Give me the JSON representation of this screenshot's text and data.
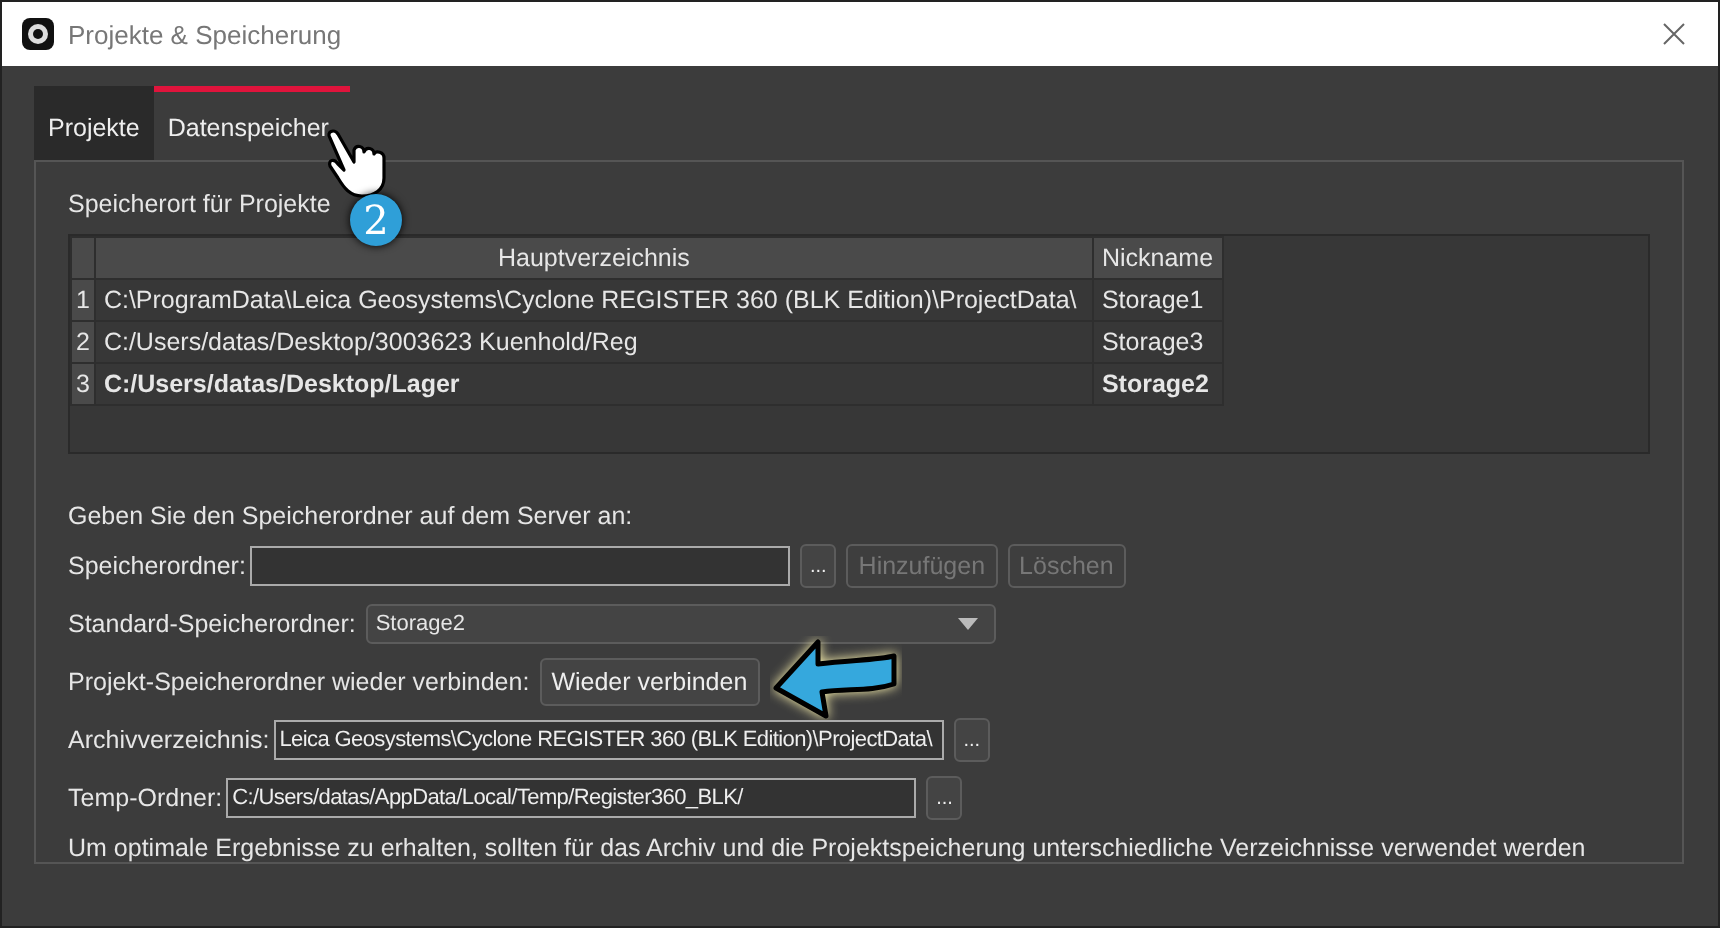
{
  "window": {
    "title": "Projekte & Speicherung"
  },
  "tabs": [
    {
      "label": "Projekte",
      "selected": false
    },
    {
      "label": "Datenspeicher",
      "selected": true
    }
  ],
  "callout": {
    "badge": "2"
  },
  "storage_table": {
    "title": "Speicherort für Projekte",
    "columns": [
      "Hauptverzeichnis",
      "Nickname"
    ],
    "rows": [
      {
        "index": "1",
        "path": "C:\\ProgramData\\Leica Geosystems\\Cyclone REGISTER 360 (BLK Edition)\\ProjectData\\",
        "nickname": "Storage1",
        "is_default": false
      },
      {
        "index": "2",
        "path": "C:/Users/datas/Desktop/3003623 Kuenhold/Reg",
        "nickname": "Storage3",
        "is_default": false
      },
      {
        "index": "3",
        "path": "C:/Users/datas/Desktop/Lager",
        "nickname": "Storage2",
        "is_default": true
      }
    ]
  },
  "server_prompt": "Geben Sie den Speicherordner auf dem Server an:",
  "storage_folder": {
    "label": "Speicherordner:",
    "browse": "...",
    "add": {
      "label": "Hinzufügen",
      "disabled": true
    },
    "delete": {
      "label": "Löschen",
      "disabled": true
    }
  },
  "default_folder": {
    "label": "Standard-Speicherordner:",
    "value": "Storage2"
  },
  "reconnect": {
    "label": "Projekt-Speicherordner wieder verbinden:",
    "button": "Wieder verbinden"
  },
  "archive": {
    "label": "Archivverzeichnis:",
    "value": "Leica Geosystems\\Cyclone REGISTER 360 (BLK Edition)\\ProjectData\\",
    "browse": "..."
  },
  "temp": {
    "label": "Temp-Ordner:",
    "value": "C:/Users/datas/AppData/Local/Temp/Register360_BLK/",
    "browse": "..."
  },
  "note": "Um optimale Ergebnisse zu erhalten, sollten für das Archiv und die Projektspeicherung unterschiedliche Verzeichnisse verwendet werden"
}
